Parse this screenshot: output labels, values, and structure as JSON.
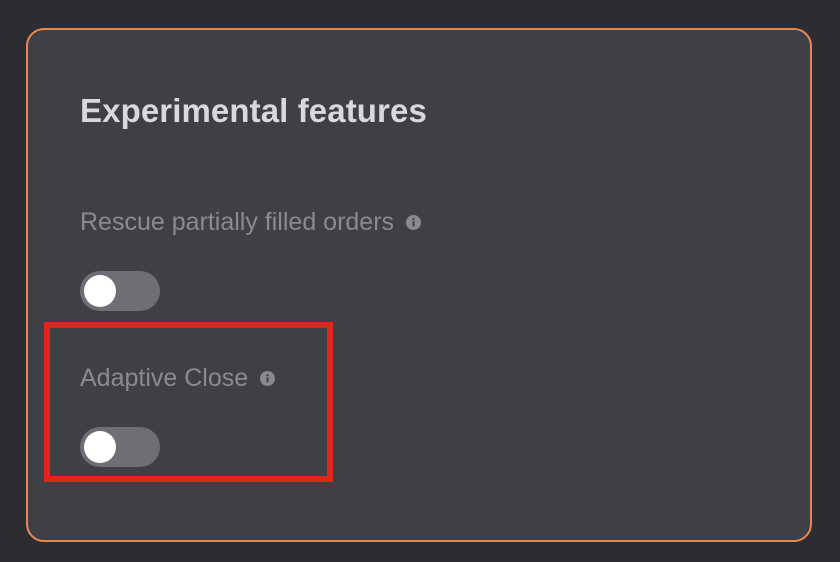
{
  "panel": {
    "title": "Experimental features",
    "features": [
      {
        "label": "Rescue partially filled orders",
        "info_icon": "info-icon",
        "enabled": false
      },
      {
        "label": "Adaptive Close",
        "info_icon": "info-icon",
        "enabled": false
      }
    ]
  },
  "colors": {
    "accent_border": "#e8884f",
    "highlight": "#e0261c",
    "panel_bg": "#3f4045"
  }
}
